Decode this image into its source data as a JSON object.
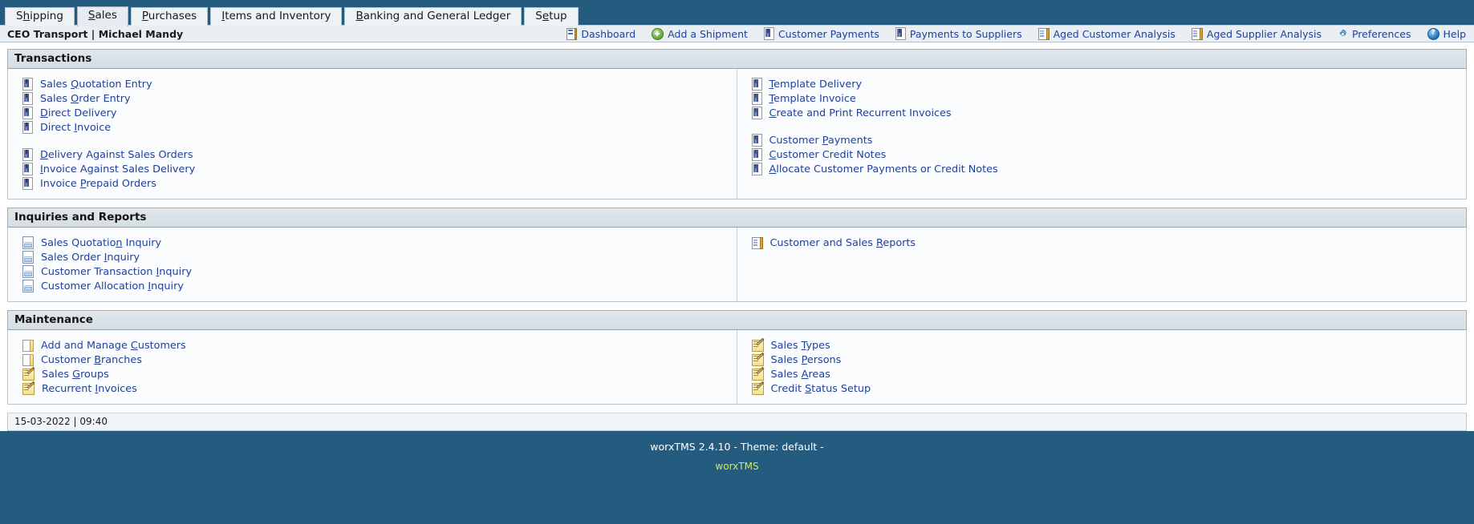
{
  "tabs": [
    {
      "label": "Shipping",
      "accel": "h",
      "active": false
    },
    {
      "label": "Sales",
      "accel": "S",
      "active": true
    },
    {
      "label": "Purchases",
      "accel": "P",
      "active": false
    },
    {
      "label": "Items and Inventory",
      "accel": "I",
      "active": false
    },
    {
      "label": "Banking and General Ledger",
      "accel": "B",
      "active": false
    },
    {
      "label": "Setup",
      "accel": "e",
      "active": false
    }
  ],
  "topbar": {
    "user_info": "CEO Transport | Michael Mandy",
    "quick_menu": [
      {
        "label": "Dashboard",
        "icon": "dashboard-icon"
      },
      {
        "label": "Add a Shipment",
        "icon": "add-circle-icon"
      },
      {
        "label": "Customer Payments",
        "icon": "book-icon"
      },
      {
        "label": "Payments to Suppliers",
        "icon": "book-icon"
      },
      {
        "label": "Aged Customer Analysis",
        "icon": "report-icon"
      },
      {
        "label": "Aged Supplier Analysis",
        "icon": "report-icon"
      },
      {
        "label": "Preferences",
        "icon": "gear-icon"
      },
      {
        "label": "Help",
        "icon": "help-icon"
      }
    ]
  },
  "sections": [
    {
      "title": "Transactions",
      "left": [
        {
          "label": "Sales Quotation Entry",
          "accel": "Q",
          "icon": "book-icon"
        },
        {
          "label": "Sales Order Entry",
          "accel": "O",
          "icon": "book-icon"
        },
        {
          "label": "Direct Delivery",
          "accel": "D",
          "icon": "book-icon"
        },
        {
          "label": "Direct Invoice",
          "accel": "I",
          "icon": "book-icon"
        },
        {
          "type": "spacer"
        },
        {
          "label": "Delivery Against Sales Orders",
          "accel": "D",
          "icon": "book-icon"
        },
        {
          "label": "Invoice Against Sales Delivery",
          "accel": "I",
          "icon": "book-icon"
        },
        {
          "label": "Invoice Prepaid Orders",
          "accel": "P",
          "icon": "book-icon"
        }
      ],
      "right": [
        {
          "label": "Template Delivery",
          "accel": "T",
          "icon": "book-icon"
        },
        {
          "label": "Template Invoice",
          "accel": "T",
          "icon": "book-icon"
        },
        {
          "label": "Create and Print Recurrent Invoices",
          "accel": "C",
          "icon": "book-icon"
        },
        {
          "type": "spacer"
        },
        {
          "label": "Customer Payments",
          "accel": "P",
          "icon": "book-icon"
        },
        {
          "label": "Customer Credit Notes",
          "accel": "C",
          "icon": "book-icon"
        },
        {
          "label": "Allocate Customer Payments or Credit Notes",
          "accel": "A",
          "icon": "book-icon"
        }
      ]
    },
    {
      "title": "Inquiries and Reports",
      "left": [
        {
          "label": "Sales Quotation Inquiry",
          "accel": "n",
          "icon": "document-icon"
        },
        {
          "label": "Sales Order Inquiry",
          "accel": "I",
          "icon": "document-icon"
        },
        {
          "label": "Customer Transaction Inquiry",
          "accel": "I",
          "icon": "document-icon"
        },
        {
          "label": "Customer Allocation Inquiry",
          "accel": "I",
          "icon": "document-icon"
        }
      ],
      "right": [
        {
          "label": "Customer and Sales Reports",
          "accel": "R",
          "icon": "report-icon"
        }
      ]
    },
    {
      "title": "Maintenance",
      "left": [
        {
          "label": "Add and Manage Customers",
          "accel": "C",
          "icon": "note-icon"
        },
        {
          "label": "Customer Branches",
          "accel": "B",
          "icon": "note-icon"
        },
        {
          "label": "Sales Groups",
          "accel": "G",
          "icon": "pencil-note-icon"
        },
        {
          "label": "Recurrent Invoices",
          "accel": "I",
          "icon": "pencil-note-icon"
        }
      ],
      "right": [
        {
          "label": "Sales Types",
          "accel": "T",
          "icon": "pencil-note-icon"
        },
        {
          "label": "Sales Persons",
          "accel": "P",
          "icon": "pencil-note-icon"
        },
        {
          "label": "Sales Areas",
          "accel": "A",
          "icon": "pencil-note-icon"
        },
        {
          "label": "Credit Status Setup",
          "accel": "S",
          "icon": "pencil-note-icon"
        }
      ]
    }
  ],
  "status": {
    "date": "15-03-2022",
    "separator": "|",
    "time": "09:40",
    "text": "15-03-2022 | 09:40"
  },
  "footer": {
    "line1": "worxTMS 2.4.10 - Theme: default -",
    "line2": "worxTMS"
  },
  "colors": {
    "page_background": "#255b7e",
    "link": "#20409a",
    "section_header": "#dfe7ec",
    "footer_link": "#d8e84b"
  }
}
